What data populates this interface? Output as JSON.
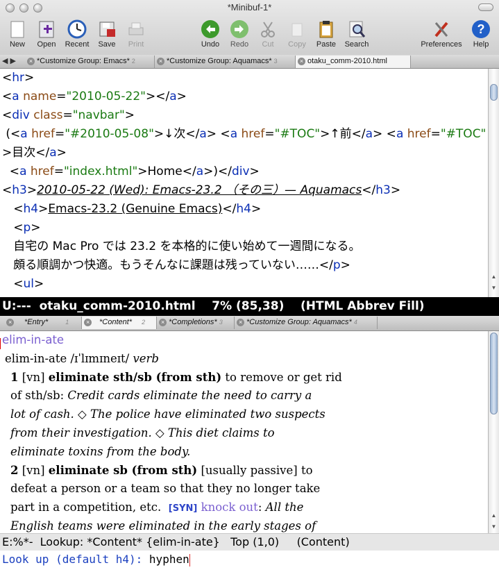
{
  "window": {
    "title": "*Minibuf-1*"
  },
  "toolbar": {
    "new": "New",
    "open": "Open",
    "recent": "Recent",
    "save": "Save",
    "print": "Print",
    "undo": "Undo",
    "redo": "Redo",
    "cut": "Cut",
    "copy": "Copy",
    "paste": "Paste",
    "search": "Search",
    "preferences": "Preferences",
    "help": "Help"
  },
  "top_tabs": {
    "new_label": "◀ ▶",
    "items": [
      {
        "label": "*Customize Group: Emacs*",
        "num": "2"
      },
      {
        "label": "*Customize Group: Aquamacs*",
        "num": "3"
      },
      {
        "label": "otaku_comm-2010.html",
        "num": ""
      }
    ]
  },
  "code": {
    "l1": [
      "<",
      "hr",
      ">"
    ],
    "l2": [
      "<",
      "a",
      " ",
      "name",
      "=",
      "\"2010-05-22\"",
      "></",
      "a",
      ">"
    ],
    "l3": [
      "<",
      "div",
      " ",
      "class",
      "=",
      "\"navbar\"",
      ">"
    ],
    "l4": [
      " (<",
      "a",
      " ",
      "href",
      "=",
      "\"#2010-05-08\"",
      ">↓次</",
      "a",
      "> <",
      "a",
      " ",
      "href",
      "=",
      "\"#TOC\"",
      ">↑前</",
      "a",
      "> <",
      "a",
      " ",
      "href",
      "=",
      "\"#TOC\""
    ],
    "l5": [
      ">目次</",
      "a",
      ">"
    ],
    "l6": [
      "  <",
      "a",
      " ",
      "href",
      "=",
      "\"index.html\"",
      ">Home</",
      "a",
      ">)</",
      "div",
      ">"
    ],
    "l7": [
      "<",
      "h3",
      ">",
      "2010-05-22 (Wed): Emacs-23.2 （その三）— Aquamacs",
      "</",
      "h3",
      ">"
    ],
    "l8": [
      "   <",
      "h4",
      ">",
      "Emacs-23.2 (Genuine Emacs)",
      "</",
      "h4",
      ">"
    ],
    "l9": [
      "   <",
      "p",
      ">"
    ],
    "l10": "   自宅の Mac Pro では 23.2 を本格的に使い始めて一週間になる。",
    "l11": [
      "   頗る順調かつ快適。もうそんなに課題は残っていない……</",
      "p",
      ">"
    ],
    "l12": [
      "   <",
      "ul",
      ">"
    ]
  },
  "modeline_top": "U:---  otaku_comm-2010.html    7% (85,38)    (HTML Abbrev Fill)",
  "bottom_tabs": [
    {
      "label": "*Entry*",
      "num": "1"
    },
    {
      "label": "*Content*",
      "num": "2"
    },
    {
      "label": "*Completions*",
      "num": "3"
    },
    {
      "label": "*Customize Group: Aquamacs*",
      "num": "4"
    }
  ],
  "dict": {
    "headword": "elim-in-ate",
    "pron": "elim-in-ate /ɪˈlɪmɪneɪt/ ",
    "pos": "verb",
    "s1_num": "1",
    "s1_code": " [vn] ",
    "s1_pattern": "eliminate sth/sb (from sth)",
    "s1_def_a": " to remove or get rid",
    "s1_def_b": "of sth/sb: ",
    "s1_ex_a": "Credit cards eliminate the need to carry a",
    "s1_ex_b": "lot of cash. ◇ The police have eliminated two suspects",
    "s1_ex_c": "from their investigation. ◇ This diet claims to",
    "s1_ex_d": "eliminate toxins from the body.",
    "s2_num": "2",
    "s2_code": " [vn] ",
    "s2_pattern": "eliminate sb (from sth)",
    "s2_def_a": " [usually passive] to",
    "s2_def_b": "defeat a person or a team so that they no longer take",
    "s2_def_c": "part in a competition, etc.  ",
    "syn_tag": "[SYN]",
    "syn_word": " knock out",
    "s2_def_d": ": ",
    "s2_ex_a": "All the",
    "s2_ex_b": "English teams were eliminated in the early stages of"
  },
  "modeline_bottom": "E:%*-  Lookup: *Content* {elim-in-ate}   Top (1,0)     (Content)",
  "minibuffer": {
    "prompt": "Look up (default h4): ",
    "value": "hyphen"
  }
}
